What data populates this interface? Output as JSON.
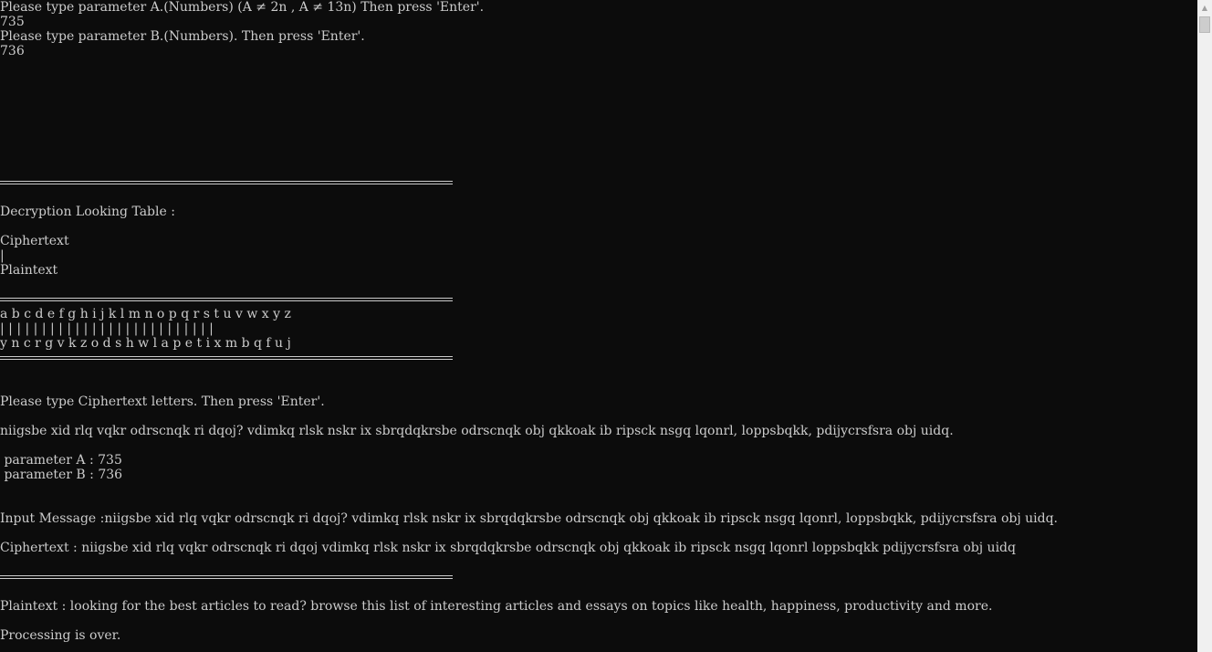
{
  "console": {
    "colors": {
      "background": "#0c0c0c",
      "text": "#cccccc",
      "scrollbar": "#f0f0f0"
    },
    "prompt_a": "Please type parameter A.(Numbers) (A ≠ 2n , A ≠ 13n) Then press 'Enter'.",
    "value_a": "735",
    "prompt_b": "Please type parameter B.(Numbers). Then press 'Enter'.",
    "value_b": "736",
    "table_title": "Decryption Looking Table :",
    "legend_cipher": "Ciphertext",
    "legend_bar": "|",
    "legend_plain": "Plaintext",
    "alphabet_cipher": "a b c d e f g h i j k l m n o p q r s t u v w x y z",
    "alphabet_bars": "| | | | | | | | | | | | | | | | | | | | | | | | | |",
    "alphabet_plain": "y n c r g v k z o d s h w l a p e t i x m b q f u j",
    "prompt_cipher": "Please type Ciphertext letters. Then press 'Enter'.",
    "cipher_input": "niigsbe xid rlq vqkr odrscnqk ri dqoj? vdimkq rlsk nskr ix sbrqdqkrsbe odrscnqk obj qkkoak ib ripsck nsgq lqonrl, loppsbqkk, pdijycrsfsra obj uidq.",
    "param_a_line": " parameter A : 735",
    "param_b_line": " parameter B : 736",
    "input_message_line": "Input Message :niigsbe xid rlq vqkr odrscnqk ri dqoj? vdimkq rlsk nskr ix sbrqdqkrsbe odrscnqk obj qkkoak ib ripsck nsgq lqonrl, loppsbqkk, pdijycrsfsra obj uidq.",
    "ciphertext_line": "Ciphertext : niigsbe xid rlq vqkr odrscnqk ri dqoj vdimkq rlsk nskr ix sbrqdqkrsbe odrscnqk obj qkkoak ib ripsck nsgq lqonrl loppsbqkk pdijycrsfsra obj uidq",
    "plaintext_line": "Plaintext : looking for the best articles to read? browse this list of interesting articles and essays on topics like health, happiness, productivity and more.",
    "done_line": "Processing is over."
  },
  "scrollbar": {
    "up_icon": "▲"
  }
}
